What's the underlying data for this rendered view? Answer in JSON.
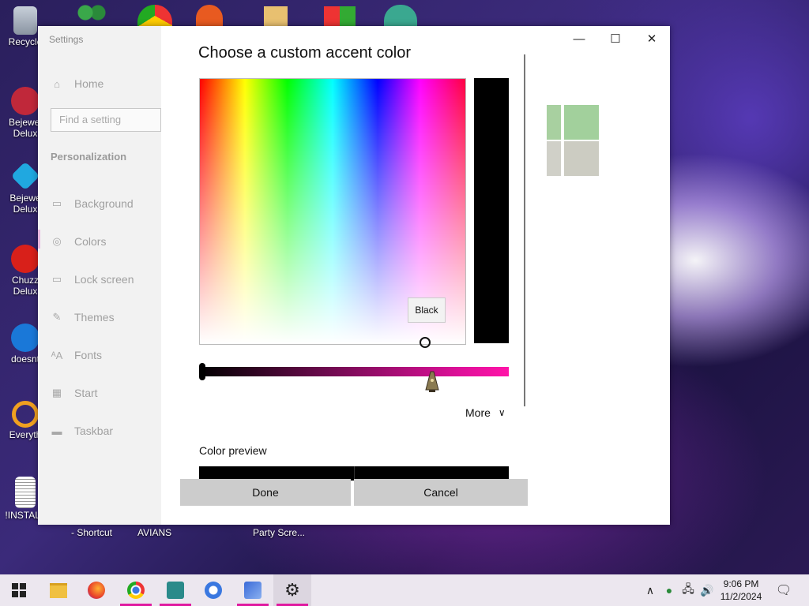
{
  "desktop": {
    "icons": [
      {
        "label": "Recycle",
        "color": "#9aa6b5"
      },
      {
        "label": "Bejewel Delux",
        "color": "#c0283a"
      },
      {
        "label": "Bejewe Delux",
        "color": "#20a8e0"
      },
      {
        "label": "Chuzz Delux",
        "color": "#d8201a"
      },
      {
        "label": "doesnt",
        "color": "#1a78d8"
      },
      {
        "label": "Everyth",
        "color": "#f0a020"
      },
      {
        "label": "!INSTALL",
        "color": "#dddddd"
      }
    ],
    "bottom_labels": [
      "- Shortcut",
      "AVIANS",
      "Party Scre..."
    ]
  },
  "settings": {
    "app_title": "Settings",
    "home_label": "Home",
    "search_placeholder": "Find a setting",
    "section_title": "Personalization",
    "nav_items": [
      {
        "label": "Background",
        "icon": "image-icon"
      },
      {
        "label": "Colors",
        "icon": "palette-icon"
      },
      {
        "label": "Lock screen",
        "icon": "lock-screen-icon"
      },
      {
        "label": "Themes",
        "icon": "brush-icon"
      },
      {
        "label": "Fonts",
        "icon": "fonts-icon"
      },
      {
        "label": "Start",
        "icon": "start-icon"
      },
      {
        "label": "Taskbar",
        "icon": "taskbar-icon"
      }
    ],
    "window_buttons": {
      "minimize": "—",
      "maximize": "☐",
      "close": "✕"
    }
  },
  "dialog": {
    "title": "Choose a custom accent color",
    "tooltip": "Black",
    "slider_value": 0,
    "more_label": "More",
    "preview_label": "Color preview",
    "done_label": "Done",
    "cancel_label": "Cancel",
    "selected_color": "#000000",
    "hue_color": "#ff14a8"
  },
  "taskbar": {
    "apps": [
      "windows-start",
      "file-explorer",
      "firefox",
      "chrome",
      "visual-studio",
      "chrome-alt",
      "network-app",
      "settings"
    ],
    "clock_time": "9:06 PM",
    "clock_date": "11/2/2024"
  }
}
